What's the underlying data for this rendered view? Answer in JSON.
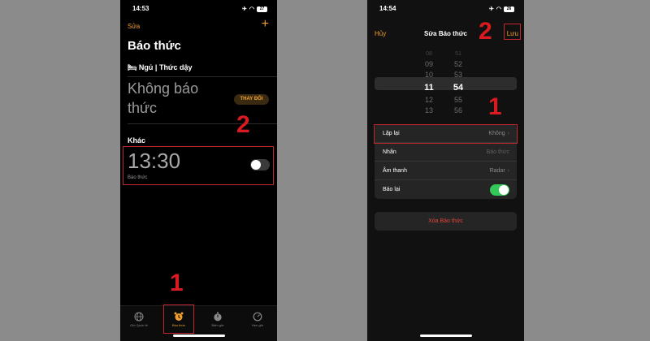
{
  "left": {
    "status": {
      "time": "14:53",
      "battery": "27"
    },
    "edit_label": "Sửa",
    "add_label": "+",
    "title": "Báo thức",
    "sleep_header": "🛏 Ngủ | Thức dậy",
    "no_alarm_text": "Không báo thức",
    "change_button": "THAY ĐỔI",
    "other_header": "Khác",
    "alarm": {
      "time": "13:30",
      "label": "Báo thức",
      "enabled": false
    },
    "callouts": [
      "2",
      "1"
    ],
    "tabs": [
      {
        "label": "Giờ Quốc tế",
        "icon": "globe-icon",
        "active": false
      },
      {
        "label": "Báo thức",
        "icon": "alarm-clock-icon",
        "active": true
      },
      {
        "label": "Bấm giờ",
        "icon": "stopwatch-icon",
        "active": false
      },
      {
        "label": "Hẹn giờ",
        "icon": "timer-icon",
        "active": false
      }
    ]
  },
  "right": {
    "status": {
      "time": "14:54",
      "battery": "26"
    },
    "cancel_label": "Hủy",
    "title": "Sửa Báo thức",
    "save_label": "Lưu",
    "picker": {
      "hours": [
        "08",
        "09",
        "10",
        "11",
        "12",
        "13",
        "14"
      ],
      "minutes": [
        "51",
        "52",
        "53",
        "54",
        "55",
        "56",
        "57"
      ],
      "selected_index": 3
    },
    "settings": [
      {
        "label": "Lặp lại",
        "value": "Không",
        "chevron": true
      },
      {
        "label": "Nhãn",
        "value": "Báo thức",
        "placeholder": true
      },
      {
        "label": "Âm thanh",
        "value": "Radar",
        "chevron": true
      },
      {
        "label": "Báo lại",
        "toggle": true
      }
    ],
    "delete_label": "Xóa Báo thức",
    "callouts": [
      "2",
      "1"
    ]
  },
  "colors": {
    "accent": "#f0a02e",
    "callout": "#d91a20",
    "toggle_on": "#34c759",
    "delete": "#e5433a"
  }
}
